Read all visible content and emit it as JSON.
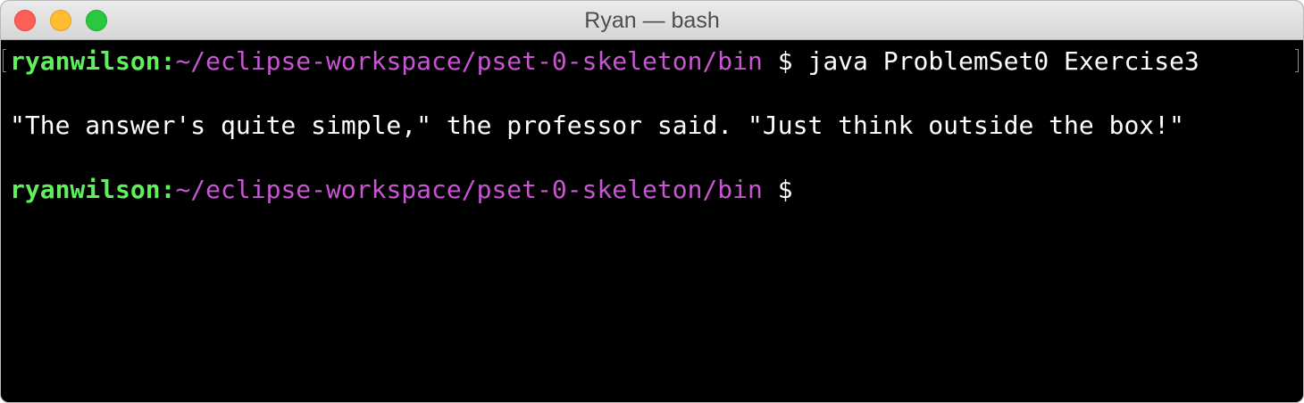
{
  "window": {
    "title": "Ryan — bash"
  },
  "terminal": {
    "background": "#000000",
    "user_color": "#5ff15a",
    "path_color": "#c955d4",
    "lines": [
      {
        "user": "ryanwilson",
        "separator": ":",
        "path": "~/eclipse-workspace/pset-0-skeleton/bin",
        "prompt": " $ ",
        "command": "java ProblemSet0 Exercise3"
      },
      {
        "output": "\"The answer's quite simple,\" the professor said. \"Just think outside the box!\""
      },
      {
        "user": "ryanwilson",
        "separator": ":",
        "path": "~/eclipse-workspace/pset-0-skeleton/bin",
        "prompt": " $ ",
        "command": ""
      }
    ]
  }
}
